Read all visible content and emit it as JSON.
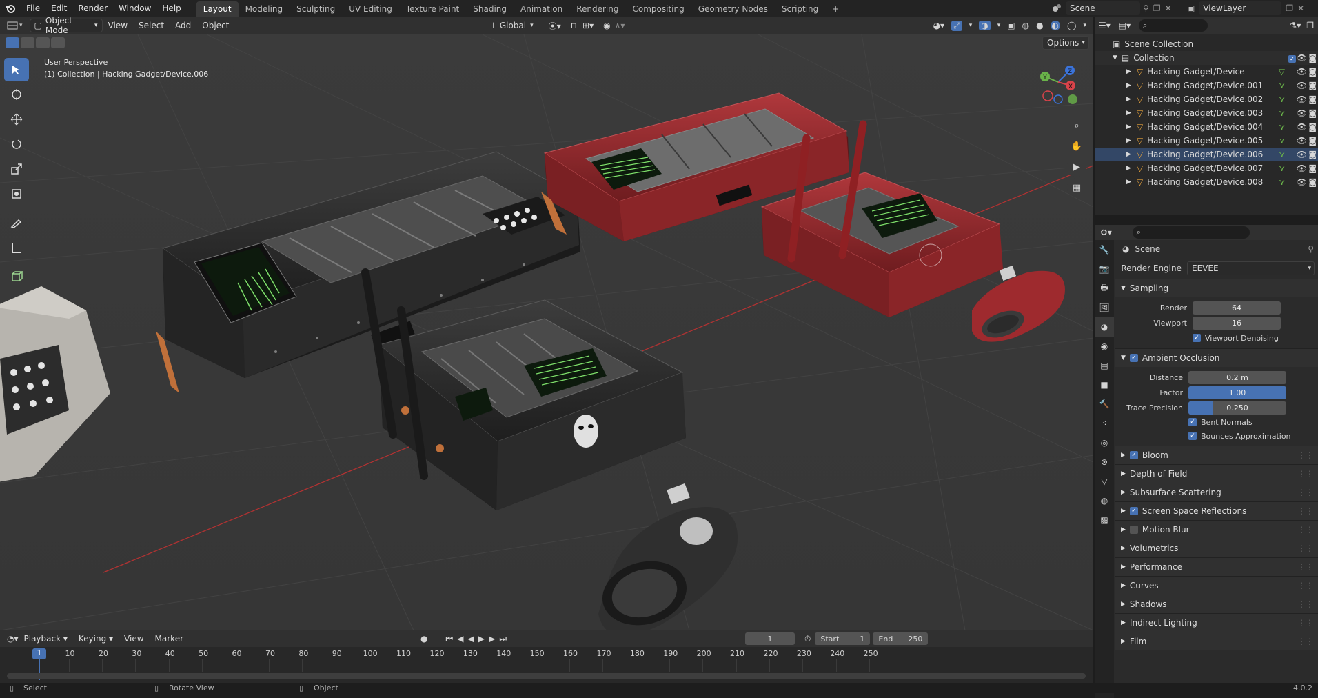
{
  "topbar": {
    "menus": [
      "File",
      "Edit",
      "Render",
      "Window",
      "Help"
    ],
    "workspaces": [
      "Layout",
      "Modeling",
      "Sculpting",
      "UV Editing",
      "Texture Paint",
      "Shading",
      "Animation",
      "Rendering",
      "Compositing",
      "Geometry Nodes",
      "Scripting"
    ],
    "active_workspace": "Layout",
    "add_tab": "+",
    "scene": "Scene",
    "view_layer": "ViewLayer"
  },
  "viewport_header": {
    "mode": "Object Mode",
    "menus": [
      "View",
      "Select",
      "Add",
      "Object"
    ],
    "transform_orientation": "Global",
    "options": "Options"
  },
  "viewport": {
    "perspective": "User Perspective",
    "context": "(1) Collection | Hacking Gadget/Device.006",
    "gizmo_axes": [
      "X",
      "Y",
      "Z"
    ],
    "screen_texts": [
      "# #",
      "# #"
    ]
  },
  "outliner": {
    "scene_collection": "Scene Collection",
    "collection": "Collection",
    "items": [
      "Hacking Gadget/Device",
      "Hacking Gadget/Device.001",
      "Hacking Gadget/Device.002",
      "Hacking Gadget/Device.003",
      "Hacking Gadget/Device.004",
      "Hacking Gadget/Device.005",
      "Hacking Gadget/Device.006",
      "Hacking Gadget/Device.007",
      "Hacking Gadget/Device.008"
    ]
  },
  "properties": {
    "context": "Scene",
    "render_engine_label": "Render Engine",
    "render_engine": "EEVEE",
    "sampling": {
      "title": "Sampling",
      "render_label": "Render",
      "render": "64",
      "viewport_label": "Viewport",
      "viewport": "16",
      "denoise": "Viewport Denoising"
    },
    "ao": {
      "title": "Ambient Occlusion",
      "distance_label": "Distance",
      "distance": "0.2 m",
      "factor_label": "Factor",
      "factor": "1.00",
      "factor_fill": 1.0,
      "trace_label": "Trace Precision",
      "trace": "0.250",
      "trace_fill": 0.25,
      "bent": "Bent Normals",
      "bounces": "Bounces Approximation"
    },
    "sections": [
      {
        "label": "Bloom",
        "checkbox": true,
        "checked": true
      },
      {
        "label": "Depth of Field",
        "checkbox": false,
        "checked": false
      },
      {
        "label": "Subsurface Scattering",
        "checkbox": false,
        "checked": false
      },
      {
        "label": "Screen Space Reflections",
        "checkbox": true,
        "checked": true
      },
      {
        "label": "Motion Blur",
        "checkbox": true,
        "checked": false
      },
      {
        "label": "Volumetrics",
        "checkbox": false,
        "checked": false
      },
      {
        "label": "Performance",
        "checkbox": false,
        "checked": false
      },
      {
        "label": "Curves",
        "checkbox": false,
        "checked": false
      },
      {
        "label": "Shadows",
        "checkbox": false,
        "checked": false
      },
      {
        "label": "Indirect Lighting",
        "checkbox": false,
        "checked": false
      },
      {
        "label": "Film",
        "checkbox": false,
        "checked": false
      }
    ]
  },
  "timeline": {
    "menus": [
      "Playback",
      "Keying",
      "View",
      "Marker"
    ],
    "current_frame": "1",
    "start_label": "Start",
    "start": "1",
    "end_label": "End",
    "end": "250",
    "ticks": [
      "10",
      "20",
      "30",
      "40",
      "50",
      "60",
      "70",
      "80",
      "90",
      "100",
      "110",
      "120",
      "130",
      "140",
      "150",
      "160",
      "170",
      "180",
      "190",
      "200",
      "210",
      "220",
      "230",
      "240",
      "250"
    ],
    "playhead": "1"
  },
  "statusbar": {
    "select": "Select",
    "rotate": "Rotate View",
    "object": "Object",
    "version": "4.0.2"
  },
  "colors": {
    "accent": "#4772b3",
    "red_device": "#9e2a2e",
    "grid": "#3d3d3d",
    "x_axis": "#c23a3a"
  }
}
